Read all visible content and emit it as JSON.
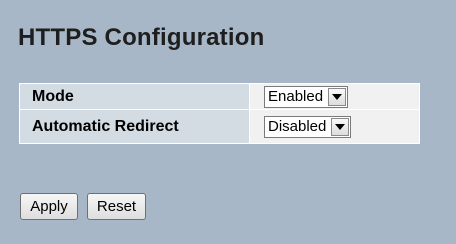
{
  "page": {
    "title": "HTTPS Configuration"
  },
  "settings": [
    {
      "label": "Mode",
      "value": "Enabled"
    },
    {
      "label": "Automatic Redirect",
      "value": "Disabled"
    }
  ],
  "buttons": {
    "apply_label": "Apply",
    "reset_label": "Reset"
  },
  "icons": {
    "dropdown": "chevron-down-icon"
  },
  "colors": {
    "background": "#a7b7c7",
    "param_cell": "#d3dce3",
    "value_cell": "#f1f1f1"
  }
}
